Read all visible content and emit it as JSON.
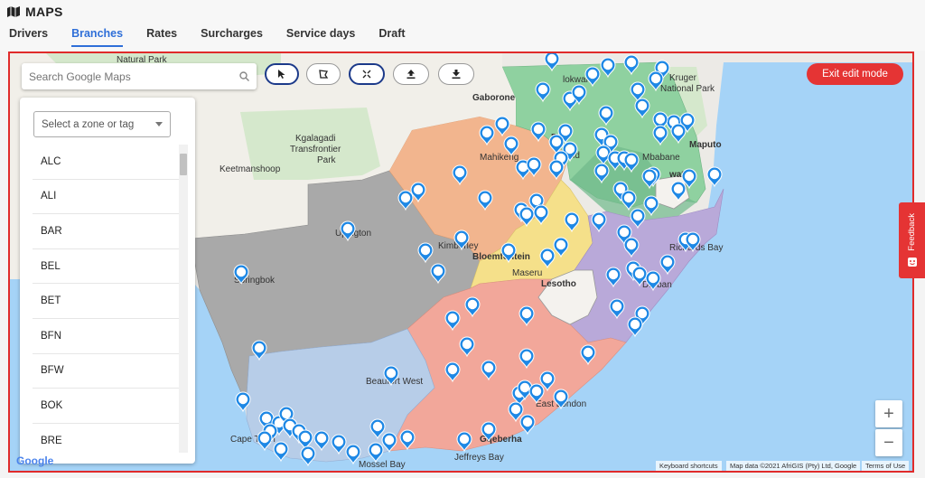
{
  "app": {
    "title": "MAPS",
    "icon": "map-icon"
  },
  "tabs": [
    {
      "label": "Drivers",
      "active": false
    },
    {
      "label": "Branches",
      "active": true
    },
    {
      "label": "Rates",
      "active": false
    },
    {
      "label": "Surcharges",
      "active": false
    },
    {
      "label": "Service days",
      "active": false
    },
    {
      "label": "Draft",
      "active": false
    }
  ],
  "search": {
    "placeholder": "Search Google Maps",
    "value": "",
    "icon": "search-icon"
  },
  "toolbar": {
    "tools": [
      {
        "name": "select-tool",
        "icon": "cursor-icon",
        "glyph": "➤"
      },
      {
        "name": "draw-tool",
        "icon": "polygon-icon",
        "glyph": "⌗"
      },
      {
        "name": "split-tool",
        "icon": "split-icon",
        "glyph": "✂"
      },
      {
        "name": "upload-tool",
        "icon": "upload-icon",
        "glyph": "⬆"
      },
      {
        "name": "download-tool",
        "icon": "download-icon",
        "glyph": "⬇"
      }
    ],
    "exit_label": "Exit edit mode"
  },
  "zone_panel": {
    "select_placeholder": "Select a zone or tag",
    "items": [
      "ALC",
      "ALI",
      "BAR",
      "BEL",
      "BET",
      "BFN",
      "BFW",
      "BOK",
      "BRE"
    ]
  },
  "map_labels": {
    "natural_park": "Natural Park",
    "gaborone": "Gaborone",
    "polokwane": "Polokwane",
    "polokwane_short": "lokwane",
    "kruger": "Kruger",
    "national_park": "National Park",
    "maputo": "Maputo",
    "mbabane": "Mbabane",
    "eswatini": "Eswatini",
    "eswatini_short": "watini",
    "pretoria": "Pretoria",
    "pretoria_short": "P",
    "mahikeng": "Mahikeng",
    "kgalagadi_1": "Kgalagadi",
    "kgalagadi_2": "Transfrontier",
    "kgalagadi_3": "Park",
    "keetmanshoop": "Keetmanshoop",
    "upington": "Upington",
    "kimberley": "Kimberley",
    "bloemfontein": "Bloemfontein",
    "maseru": "Maseru",
    "lesotho": "Lesotho",
    "richards_bay": "Richards Bay",
    "durban": "Durban",
    "springbok": "Springbok",
    "beaufort_west": "Beaufort West",
    "east_london": "East London",
    "cape_town": "Cape Town",
    "mossel_bay": "Mossel Bay",
    "gqeberha": "Gqeberha",
    "jeffreys_bay": "Jeffreys Bay",
    "land": "land"
  },
  "attribution": {
    "shortcuts": "Keyboard shortcuts",
    "map_data": "Map data ©2021 AfriGIS (Pty) Ltd, Google",
    "terms": "Terms of Use",
    "google": "Google"
  },
  "zoom": {
    "in": "+",
    "out": "−"
  },
  "feedback": {
    "label": "Feedback"
  },
  "colors": {
    "accent": "#2f6fd8",
    "exit_button": "#e53434",
    "pin": "#1e88e5",
    "zone_grey": "#a9a9a9",
    "zone_orange": "#f2b58e",
    "zone_green": "#8fd1a0",
    "zone_yellow": "#f5e08a",
    "zone_purple": "#b9a9d9",
    "zone_red": "#f2a79a",
    "zone_blue": "#b7cde8",
    "sea": "#a5d3f7"
  }
}
